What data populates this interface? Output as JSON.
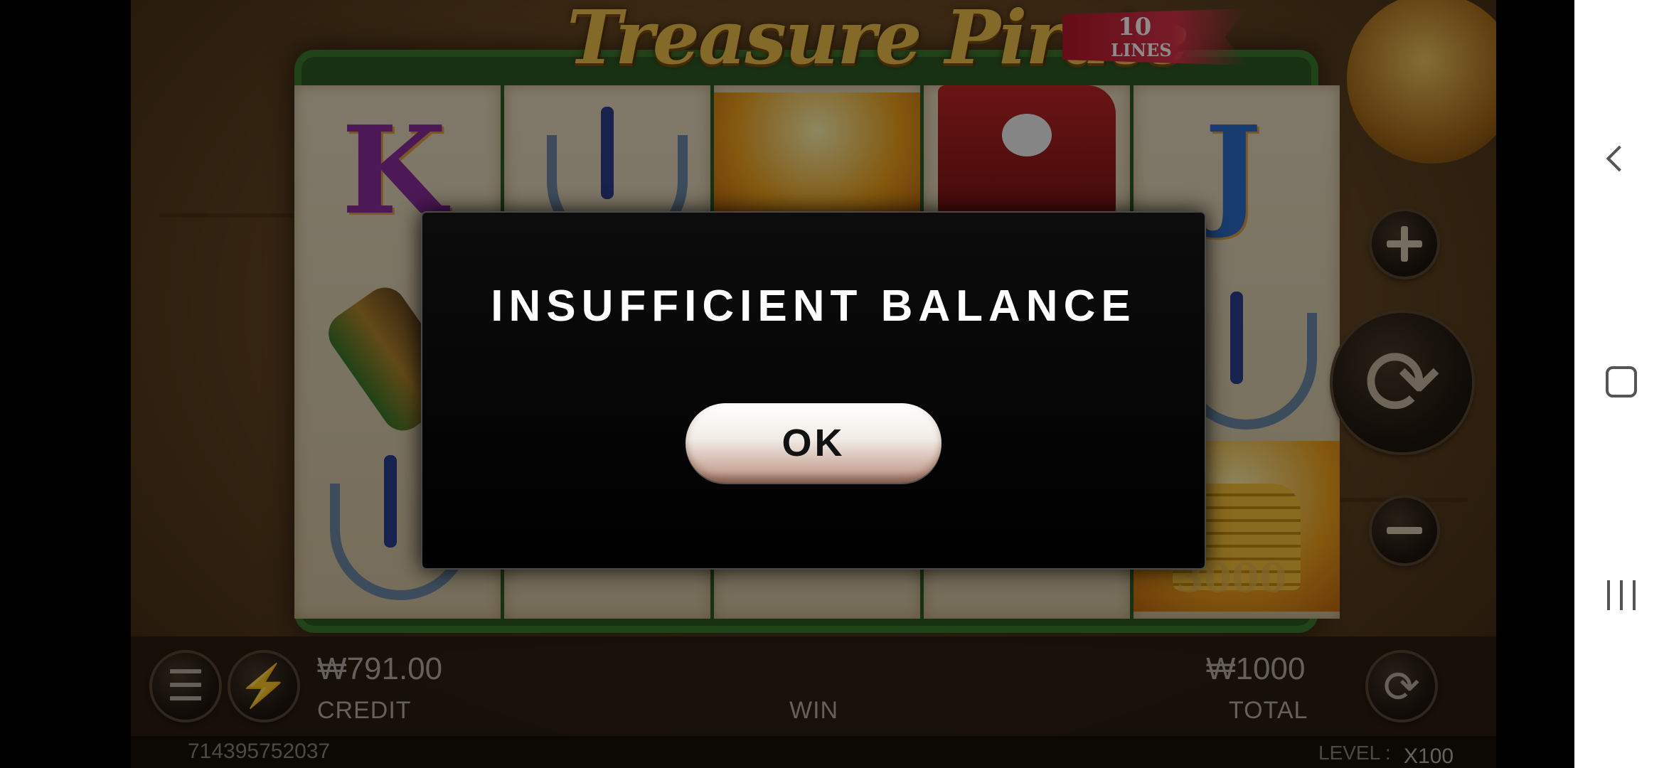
{
  "game": {
    "title": "Treasure Pirate",
    "lines_number": "10",
    "lines_label": "LINES",
    "reel_symbol_k": "K",
    "reel_symbol_j": "J",
    "coin_value": "3000"
  },
  "dialog": {
    "title": "INSUFFICIENT BALANCE",
    "ok_label": "OK"
  },
  "bottom_bar": {
    "credit_value": "₩791.00",
    "credit_label": "CREDIT",
    "win_label": "WIN",
    "total_value": "₩1000",
    "total_label": "TOTAL",
    "session_id": "714395752037",
    "level_label": "LEVEL :",
    "level_value": "X100"
  },
  "colors": {
    "dialog_bg": "#000000",
    "title_gold": "#f0c24a",
    "board_green": "#2d5a24"
  },
  "icons": [
    "menu-icon",
    "lightning-icon",
    "autoplay-icon",
    "plus-icon",
    "minus-icon",
    "spin-icon",
    "back-icon",
    "home-icon",
    "recent-apps-icon"
  ]
}
